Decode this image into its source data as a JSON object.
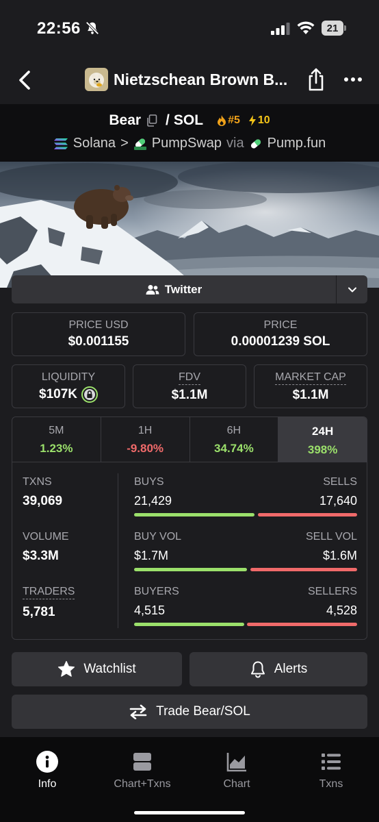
{
  "status_bar": {
    "time": "22:56",
    "battery": "21"
  },
  "nav": {
    "title": "Nietzschean Brown B..."
  },
  "pair": {
    "base": "Bear",
    "separator": "/",
    "quote": "SOL",
    "rank_fire": "#5",
    "rank_bolt": "10",
    "chain": "Solana",
    "chevron": ">",
    "dex": "PumpSwap",
    "via": "via",
    "launchpad": "Pump.fun"
  },
  "social": {
    "twitter_label": "Twitter"
  },
  "prices": {
    "price_usd_label": "PRICE USD",
    "price_usd": "$0.001155",
    "price_label": "PRICE",
    "price_sol": "0.00001239 SOL"
  },
  "metrics": {
    "liquidity_label": "LIQUIDITY",
    "liquidity": "$107K",
    "fdv_label": "FDV",
    "fdv": "$1.1M",
    "mcap_label": "MARKET CAP",
    "mcap": "$1.1M"
  },
  "timeframes": [
    {
      "label": "5M",
      "change": "1.23%"
    },
    {
      "label": "1H",
      "change": "-9.80%"
    },
    {
      "label": "6H",
      "change": "34.74%"
    },
    {
      "label": "24H",
      "change": "398%"
    }
  ],
  "stats": {
    "txns_label": "TXNS",
    "txns": "39,069",
    "volume_label": "VOLUME",
    "volume": "$3.3M",
    "traders_label": "TRADERS",
    "traders": "5,781",
    "buys_label": "BUYS",
    "buys": "21,429",
    "sells_label": "SELLS",
    "sells": "17,640",
    "buy_vol_label": "BUY VOL",
    "buy_vol": "$1.7M",
    "sell_vol_label": "SELL VOL",
    "sell_vol": "$1.6M",
    "buyers_label": "BUYERS",
    "buyers": "4,515",
    "sellers_label": "SELLERS",
    "sellers": "4,528"
  },
  "actions": {
    "watchlist": "Watchlist",
    "alerts": "Alerts",
    "trade": "Trade Bear/SOL"
  },
  "tabbar": [
    {
      "label": "Info",
      "icon": "info-icon",
      "active": true
    },
    {
      "label": "Chart+Txns",
      "icon": "split-view-icon",
      "active": false
    },
    {
      "label": "Chart",
      "icon": "area-chart-icon",
      "active": false
    },
    {
      "label": "Txns",
      "icon": "list-icon",
      "active": false
    }
  ],
  "colors": {
    "positive": "#9be06b",
    "negative": "#f06a6a",
    "fire": "#f0a21a",
    "bolt": "#f5c518"
  }
}
